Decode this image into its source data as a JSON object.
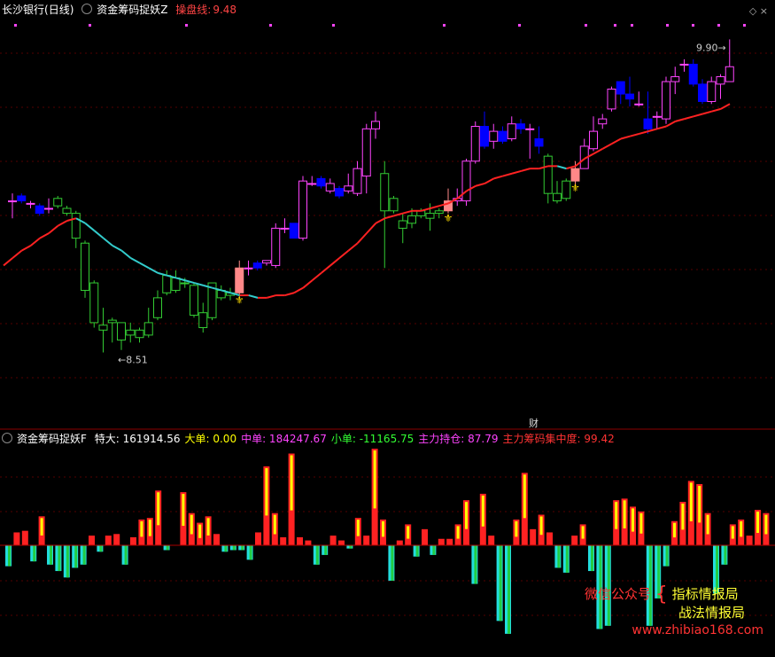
{
  "main_header": {
    "stock": "长沙银行",
    "period": "(日线)",
    "indicator": "资金筹码捉妖Z",
    "line_label": "操盘线:",
    "line_value": "9.48"
  },
  "sub_header": {
    "indicator": "资金筹码捉妖F",
    "items": [
      {
        "label": "特大:",
        "value": "161914.56",
        "color": "#ffffff"
      },
      {
        "label": "大单:",
        "value": "0.00",
        "color": "#ffff00"
      },
      {
        "label": "中单:",
        "value": "184247.67",
        "color": "#ff44ff"
      },
      {
        "label": "小单:",
        "value": "-11165.75",
        "color": "#33ff33"
      },
      {
        "label": "主力持仓:",
        "value": "87.79",
        "color": "#ff44ff"
      },
      {
        "label": "主力筹码集中度:",
        "value": "99.42",
        "color": "#ff3333"
      }
    ]
  },
  "watermark": {
    "wechat": "微信公众号",
    "line1": "指标情报局",
    "line2": "战法情报局",
    "site": "www.zhibiao168.com"
  },
  "annotations": {
    "high": "9.90",
    "low": "8.51",
    "cai": "财"
  },
  "chart_data": [
    {
      "type": "candlestick",
      "title": "资金筹码捉妖Z",
      "ylim": [
        8.42,
        10.04
      ],
      "colors": {
        "up": "#ff44ff",
        "down": "#0000ff",
        "signal": "#ff8888",
        "weak": "#33cc33"
      },
      "candles": [
        {
          "o": 9.31,
          "c": 9.31,
          "h": 9.34,
          "l": 9.24,
          "k": "u"
        },
        {
          "o": 9.33,
          "c": 9.31,
          "h": 9.34,
          "l": 9.3,
          "k": "d"
        },
        {
          "o": 9.3,
          "c": 9.3,
          "h": 9.31,
          "l": 9.28,
          "k": "u"
        },
        {
          "o": 9.29,
          "c": 9.26,
          "h": 9.3,
          "l": 9.25,
          "k": "d"
        },
        {
          "o": 9.28,
          "c": 9.28,
          "h": 9.32,
          "l": 9.26,
          "k": "u"
        },
        {
          "o": 9.29,
          "c": 9.32,
          "h": 9.33,
          "l": 9.28,
          "k": "w"
        },
        {
          "o": 9.28,
          "c": 9.26,
          "h": 9.29,
          "l": 9.25,
          "k": "w"
        },
        {
          "o": 9.26,
          "c": 9.16,
          "h": 9.27,
          "l": 9.12,
          "k": "w"
        },
        {
          "o": 9.14,
          "c": 8.95,
          "h": 9.15,
          "l": 8.92,
          "k": "w"
        },
        {
          "o": 8.98,
          "c": 8.82,
          "h": 8.99,
          "l": 8.8,
          "k": "w"
        },
        {
          "o": 8.81,
          "c": 8.79,
          "h": 8.88,
          "l": 8.7,
          "k": "w"
        },
        {
          "o": 8.82,
          "c": 8.83,
          "h": 8.84,
          "l": 8.74,
          "k": "w"
        },
        {
          "o": 8.82,
          "c": 8.75,
          "h": 8.82,
          "l": 8.71,
          "k": "w"
        },
        {
          "o": 8.79,
          "c": 8.77,
          "h": 8.82,
          "l": 8.74,
          "k": "w"
        },
        {
          "o": 8.79,
          "c": 8.76,
          "h": 8.8,
          "l": 8.74,
          "k": "w"
        },
        {
          "o": 8.77,
          "c": 8.82,
          "h": 8.88,
          "l": 8.76,
          "k": "w"
        },
        {
          "o": 8.84,
          "c": 8.92,
          "h": 8.95,
          "l": 8.83,
          "k": "w"
        },
        {
          "o": 8.94,
          "c": 9.01,
          "h": 9.03,
          "l": 8.93,
          "k": "w"
        },
        {
          "o": 9.0,
          "c": 8.95,
          "h": 9.03,
          "l": 8.94,
          "k": "w"
        },
        {
          "o": 8.98,
          "c": 8.98,
          "h": 9.0,
          "l": 8.96,
          "k": "w"
        },
        {
          "o": 8.97,
          "c": 8.85,
          "h": 8.98,
          "l": 8.84,
          "k": "w"
        },
        {
          "o": 8.86,
          "c": 8.8,
          "h": 8.9,
          "l": 8.78,
          "k": "w"
        },
        {
          "o": 8.84,
          "c": 8.98,
          "h": 8.98,
          "l": 8.83,
          "k": "w"
        },
        {
          "o": 8.95,
          "c": 8.92,
          "h": 8.97,
          "l": 8.91,
          "k": "w"
        },
        {
          "o": 8.94,
          "c": 8.93,
          "h": 8.96,
          "l": 8.91,
          "k": "w"
        },
        {
          "o": 8.94,
          "c": 9.04,
          "h": 9.07,
          "l": 8.93,
          "k": "s"
        },
        {
          "o": 9.04,
          "c": 9.04,
          "h": 9.07,
          "l": 9.01,
          "k": "u"
        },
        {
          "o": 9.04,
          "c": 9.06,
          "h": 9.07,
          "l": 9.03,
          "k": "d"
        },
        {
          "o": 9.06,
          "c": 9.07,
          "h": 9.07,
          "l": 9.05,
          "k": "u"
        },
        {
          "o": 9.05,
          "c": 9.2,
          "h": 9.22,
          "l": 9.04,
          "k": "u"
        },
        {
          "o": 9.2,
          "c": 9.2,
          "h": 9.24,
          "l": 9.18,
          "k": "u"
        },
        {
          "o": 9.22,
          "c": 9.16,
          "h": 9.22,
          "l": 9.16,
          "k": "d"
        },
        {
          "o": 9.16,
          "c": 9.39,
          "h": 9.41,
          "l": 9.15,
          "k": "u"
        },
        {
          "o": 9.38,
          "c": 9.38,
          "h": 9.41,
          "l": 9.37,
          "k": "u"
        },
        {
          "o": 9.4,
          "c": 9.37,
          "h": 9.41,
          "l": 9.36,
          "k": "d"
        },
        {
          "o": 9.38,
          "c": 9.35,
          "h": 9.4,
          "l": 9.34,
          "k": "u"
        },
        {
          "o": 9.36,
          "c": 9.33,
          "h": 9.37,
          "l": 9.32,
          "k": "d"
        },
        {
          "o": 9.35,
          "c": 9.37,
          "h": 9.42,
          "l": 9.34,
          "k": "u"
        },
        {
          "o": 9.34,
          "c": 9.44,
          "h": 9.47,
          "l": 9.33,
          "k": "u"
        },
        {
          "o": 9.41,
          "c": 9.6,
          "h": 9.62,
          "l": 9.34,
          "k": "u"
        },
        {
          "o": 9.6,
          "c": 9.63,
          "h": 9.67,
          "l": 9.56,
          "k": "u"
        },
        {
          "o": 9.27,
          "c": 9.42,
          "h": 9.47,
          "l": 9.04,
          "k": "w"
        },
        {
          "o": 9.27,
          "c": 9.32,
          "h": 9.33,
          "l": 9.26,
          "k": "w"
        },
        {
          "o": 9.23,
          "c": 9.2,
          "h": 9.26,
          "l": 9.14,
          "k": "w"
        },
        {
          "o": 9.22,
          "c": 9.25,
          "h": 9.28,
          "l": 9.2,
          "k": "w"
        },
        {
          "o": 9.25,
          "c": 9.27,
          "h": 9.28,
          "l": 9.24,
          "k": "w"
        },
        {
          "o": 9.26,
          "c": 9.24,
          "h": 9.3,
          "l": 9.19,
          "k": "w"
        },
        {
          "o": 9.26,
          "c": 9.27,
          "h": 9.28,
          "l": 9.24,
          "k": "w"
        },
        {
          "o": 9.27,
          "c": 9.31,
          "h": 9.36,
          "l": 9.26,
          "k": "s"
        },
        {
          "o": 9.31,
          "c": 9.32,
          "h": 9.36,
          "l": 9.29,
          "k": "u"
        },
        {
          "o": 9.31,
          "c": 9.47,
          "h": 9.48,
          "l": 9.29,
          "k": "u"
        },
        {
          "o": 9.47,
          "c": 9.61,
          "h": 9.63,
          "l": 9.46,
          "k": "u"
        },
        {
          "o": 9.61,
          "c": 9.53,
          "h": 9.67,
          "l": 9.52,
          "k": "d"
        },
        {
          "o": 9.55,
          "c": 9.59,
          "h": 9.62,
          "l": 9.52,
          "k": "u"
        },
        {
          "o": 9.59,
          "c": 9.55,
          "h": 9.61,
          "l": 9.54,
          "k": "d"
        },
        {
          "o": 9.56,
          "c": 9.62,
          "h": 9.65,
          "l": 9.55,
          "k": "u"
        },
        {
          "o": 9.62,
          "c": 9.6,
          "h": 9.64,
          "l": 9.58,
          "k": "d"
        },
        {
          "o": 9.6,
          "c": 9.6,
          "h": 9.62,
          "l": 9.48,
          "k": "u"
        },
        {
          "o": 9.56,
          "c": 9.53,
          "h": 9.61,
          "l": 9.5,
          "k": "d"
        },
        {
          "o": 9.49,
          "c": 9.34,
          "h": 9.5,
          "l": 9.3,
          "k": "w"
        },
        {
          "o": 9.31,
          "c": 9.34,
          "h": 9.39,
          "l": 9.3,
          "k": "w"
        },
        {
          "o": 9.32,
          "c": 9.39,
          "h": 9.4,
          "l": 9.31,
          "k": "w"
        },
        {
          "o": 9.39,
          "c": 9.44,
          "h": 9.47,
          "l": 9.37,
          "k": "s"
        },
        {
          "o": 9.44,
          "c": 9.53,
          "h": 9.56,
          "l": 9.44,
          "k": "u"
        },
        {
          "o": 9.52,
          "c": 9.59,
          "h": 9.65,
          "l": 9.51,
          "k": "u"
        },
        {
          "o": 9.62,
          "c": 9.64,
          "h": 9.66,
          "l": 9.6,
          "k": "u"
        },
        {
          "o": 9.68,
          "c": 9.76,
          "h": 9.77,
          "l": 9.67,
          "k": "u"
        },
        {
          "o": 9.79,
          "c": 9.74,
          "h": 9.79,
          "l": 9.7,
          "k": "d"
        },
        {
          "o": 9.74,
          "c": 9.72,
          "h": 9.81,
          "l": 9.69,
          "k": "d"
        },
        {
          "o": 9.7,
          "c": 9.7,
          "h": 9.75,
          "l": 9.69,
          "k": "u"
        },
        {
          "o": 9.64,
          "c": 9.6,
          "h": 9.75,
          "l": 9.58,
          "k": "d"
        },
        {
          "o": 9.65,
          "c": 9.65,
          "h": 9.67,
          "l": 9.6,
          "k": "u"
        },
        {
          "o": 9.64,
          "c": 9.79,
          "h": 9.81,
          "l": 9.62,
          "k": "u"
        },
        {
          "o": 9.79,
          "c": 9.81,
          "h": 9.85,
          "l": 9.74,
          "k": "u"
        },
        {
          "o": 9.86,
          "c": 9.86,
          "h": 9.88,
          "l": 9.83,
          "k": "u"
        },
        {
          "o": 9.86,
          "c": 9.78,
          "h": 9.88,
          "l": 9.77,
          "k": "d"
        },
        {
          "o": 9.78,
          "c": 9.71,
          "h": 9.8,
          "l": 9.7,
          "k": "d"
        },
        {
          "o": 9.71,
          "c": 9.79,
          "h": 9.81,
          "l": 9.7,
          "k": "u"
        },
        {
          "o": 9.78,
          "c": 9.81,
          "h": 9.82,
          "l": 9.72,
          "k": "u"
        },
        {
          "o": 9.79,
          "c": 9.85,
          "h": 9.96,
          "l": 9.79,
          "k": "u"
        }
      ],
      "ma_line": {
        "values": [
          9.05,
          9.08,
          9.11,
          9.13,
          9.16,
          9.18,
          9.21,
          9.23,
          9.24,
          9.22,
          9.19,
          9.16,
          9.13,
          9.11,
          9.08,
          9.06,
          9.04,
          9.02,
          9.01,
          9.0,
          8.99,
          8.98,
          8.97,
          8.96,
          8.95,
          8.94,
          8.93,
          8.93,
          8.92,
          8.92,
          8.93,
          8.93,
          8.94,
          8.96,
          8.99,
          9.02,
          9.05,
          9.08,
          9.11,
          9.14,
          9.18,
          9.22,
          9.24,
          9.25,
          9.26,
          9.27,
          9.27,
          9.28,
          9.29,
          9.3,
          9.32,
          9.35,
          9.37,
          9.38,
          9.4,
          9.41,
          9.42,
          9.43,
          9.44,
          9.44,
          9.45,
          9.45,
          9.44,
          9.45,
          9.48,
          9.5,
          9.52,
          9.54,
          9.56,
          9.57,
          9.58,
          9.59,
          9.6,
          9.61,
          9.63,
          9.64,
          9.65,
          9.66,
          9.67,
          9.68,
          9.7
        ],
        "colors": [
          "#ff2222",
          "#33cccc"
        ]
      }
    },
    {
      "type": "bar",
      "title": "资金筹码捉妖F",
      "ylim": [
        -0.65,
        0.65
      ],
      "colors": {
        "pos_outer": "#ff2222",
        "pos_inner": "#ffff00",
        "neg_outer": "#22dddd",
        "neg_inner": "#22cc44"
      },
      "values": [
        -0.13,
        0.08,
        0.09,
        -0.1,
        0.18,
        -0.12,
        -0.16,
        -0.2,
        -0.14,
        -0.12,
        0.06,
        -0.04,
        0.06,
        0.07,
        -0.12,
        0.05,
        0.16,
        0.17,
        0.34,
        -0.03,
        0.0,
        0.33,
        0.2,
        0.14,
        0.18,
        0.07,
        -0.04,
        -0.03,
        -0.03,
        -0.09,
        0.08,
        0.49,
        0.2,
        0.05,
        0.57,
        0.05,
        0.03,
        -0.12,
        -0.06,
        0.06,
        0.03,
        -0.02,
        0.17,
        0.06,
        0.6,
        0.16,
        -0.22,
        0.03,
        0.13,
        -0.07,
        0.1,
        -0.06,
        0.04,
        0.04,
        0.13,
        0.28,
        -0.24,
        0.32,
        0.06,
        -0.47,
        -0.55,
        0.16,
        0.45,
        0.1,
        0.19,
        0.08,
        -0.14,
        -0.17,
        0.06,
        0.13,
        -0.16,
        -0.52,
        -0.5,
        0.28,
        0.29,
        0.24,
        0.21,
        -0.5,
        -0.33,
        -0.13,
        0.15,
        0.27,
        0.4,
        0.38,
        0.2,
        -0.3,
        -0.12,
        0.13,
        0.16,
        0.06,
        0.22,
        0.2
      ]
    }
  ]
}
